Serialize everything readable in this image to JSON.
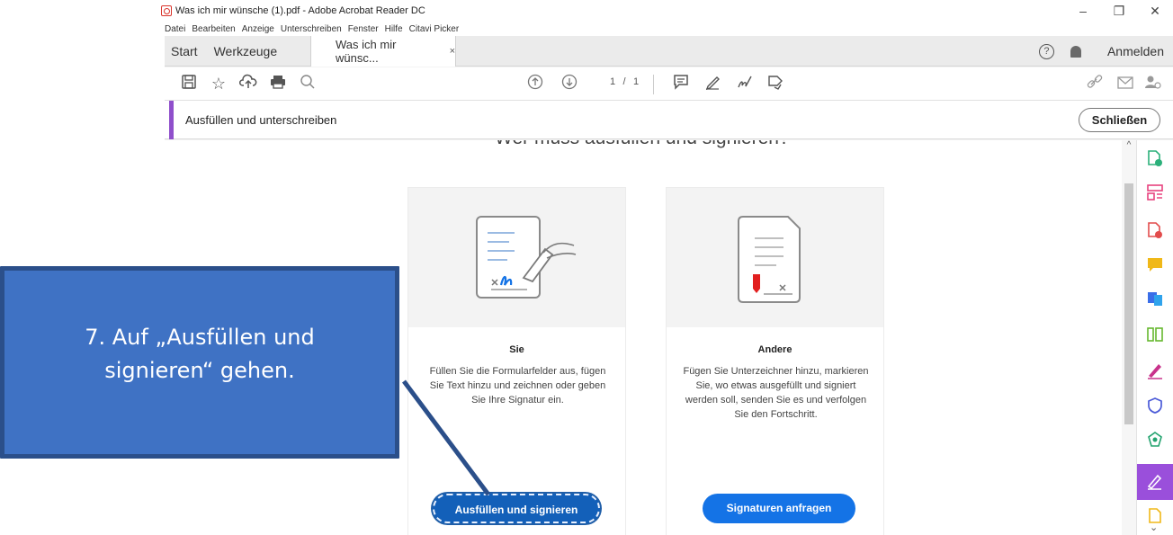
{
  "window": {
    "title": "Was ich mir wünsche (1).pdf - Adobe Acrobat Reader DC",
    "controls": [
      "–",
      "❐",
      "✕"
    ]
  },
  "menu": [
    "Datei",
    "Bearbeiten",
    "Anzeige",
    "Unterschreiben",
    "Fenster",
    "Hilfe",
    "Citavi Picker"
  ],
  "tabs": {
    "start": "Start",
    "tools": "Werkzeuge",
    "document": "Was ich mir wünsc...",
    "close": "×",
    "help": "?",
    "signin": "Anmelden"
  },
  "toolbar": {
    "page_current": "1",
    "page_separator": "/",
    "page_total": "1"
  },
  "fillbar": {
    "title": "Ausfüllen und unterschreiben",
    "close_label": "Schließen"
  },
  "content": {
    "heading": "Wer muss ausfüllen und signieren?",
    "cards": [
      {
        "name": "Sie",
        "description": "Füllen Sie die Formularfelder aus, fügen Sie Text hinzu und zeichnen oder geben Sie Ihre Signatur ein.",
        "button": "Ausfüllen und signieren"
      },
      {
        "name": "Andere",
        "description": "Fügen Sie Unterzeichner hinzu, markieren Sie, wo etwas ausgefüllt und signiert werden soll, senden Sie es und verfolgen Sie den Fortschritt.",
        "button": "Signaturen anfragen"
      }
    ]
  },
  "callout": {
    "line1": "7. Auf „Ausfüllen und",
    "line2": "signieren“ gehen."
  },
  "colors": {
    "accent_purple": "#8f4fcb",
    "button_blue": "#1473e6",
    "callout_blue": "#3f72c4"
  }
}
